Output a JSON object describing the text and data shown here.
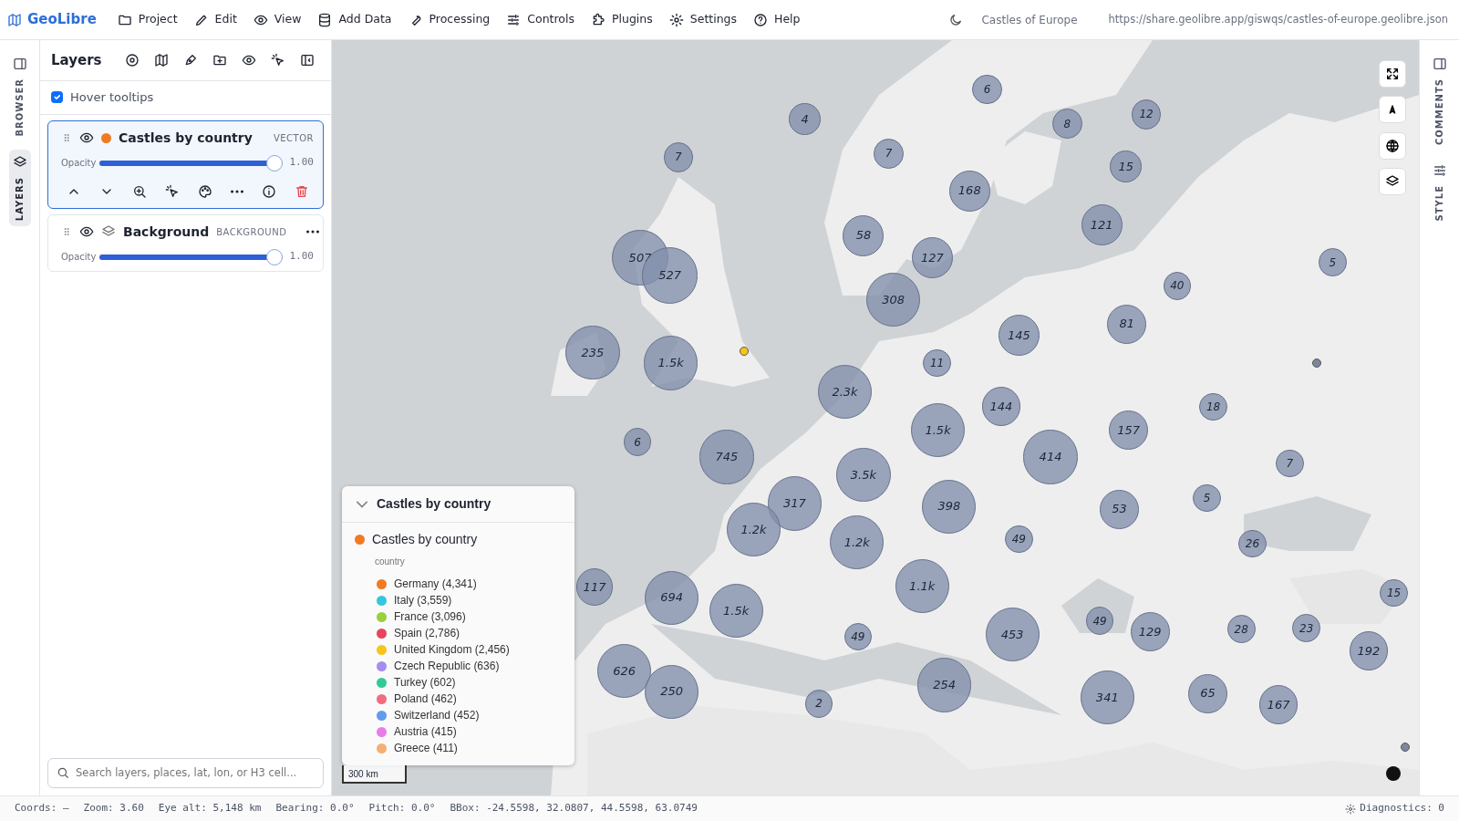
{
  "app": {
    "name": "GeoLibre"
  },
  "menu": [
    {
      "label": "Project"
    },
    {
      "label": "Edit"
    },
    {
      "label": "View"
    },
    {
      "label": "Add Data"
    },
    {
      "label": "Processing"
    },
    {
      "label": "Controls"
    },
    {
      "label": "Plugins"
    },
    {
      "label": "Settings"
    },
    {
      "label": "Help"
    }
  ],
  "project_title": "Castles of Europe",
  "share_url": "https://share.geolibre.app/giswqs/castles-of-europe.geolibre.json",
  "left_rail": {
    "tabs": [
      {
        "label": "BROWSER",
        "selected": false
      },
      {
        "label": "LAYERS",
        "selected": true
      }
    ]
  },
  "layers_panel": {
    "title": "Layers",
    "hover_tooltips": {
      "label": "Hover tooltips",
      "checked": true
    },
    "layers": [
      {
        "kind": "vector",
        "name": "Castles by country",
        "type": "VECTOR",
        "selected": true,
        "visible": true,
        "color": "#f07b22",
        "opacity_label": "Opacity",
        "level": 1.0,
        "reading": "1.00",
        "expanded": true
      },
      {
        "kind": "background",
        "name": "Background",
        "type": "BACKGROUND",
        "selected": false,
        "visible": true,
        "opacity_label": "Opacity",
        "level": 1.0,
        "reading": "1.00",
        "expanded": false
      }
    ]
  },
  "search": {
    "placeholder": "Search layers, places, lat, lon, or H3 cell..."
  },
  "map": {
    "clusters": [
      {
        "count": "6"
      },
      {
        "count": "4"
      },
      {
        "count": "8"
      },
      {
        "count": "12"
      },
      {
        "count": "7"
      },
      {
        "count": "7"
      },
      {
        "count": "15"
      },
      {
        "count": "168"
      },
      {
        "count": "121"
      },
      {
        "count": "58"
      },
      {
        "count": "507"
      },
      {
        "count": "527"
      },
      {
        "count": "127"
      },
      {
        "count": "308"
      },
      {
        "count": "40"
      },
      {
        "count": "5"
      },
      {
        "count": "81"
      },
      {
        "count": "145"
      },
      {
        "count": "235"
      },
      {
        "count": "1.5k"
      },
      {
        "count": "11"
      },
      {
        "count": "2.3k"
      },
      {
        "count": "144"
      },
      {
        "count": "18"
      },
      {
        "count": "1.5k"
      },
      {
        "count": "157"
      },
      {
        "count": "6"
      },
      {
        "count": "745"
      },
      {
        "count": "414"
      },
      {
        "count": "3.5k"
      },
      {
        "count": "7"
      },
      {
        "count": "5"
      },
      {
        "count": "317"
      },
      {
        "count": "398"
      },
      {
        "count": "53"
      },
      {
        "count": "1.2k"
      },
      {
        "count": "1.2k"
      },
      {
        "count": "49"
      },
      {
        "count": "26"
      },
      {
        "count": "117"
      },
      {
        "count": "694"
      },
      {
        "count": "1.1k"
      },
      {
        "count": "1.5k"
      },
      {
        "count": "15"
      },
      {
        "count": "49"
      },
      {
        "count": "49"
      },
      {
        "count": "453"
      },
      {
        "count": "129"
      },
      {
        "count": "28"
      },
      {
        "count": "23"
      },
      {
        "count": "192"
      },
      {
        "count": "626"
      },
      {
        "count": "250"
      },
      {
        "count": "2"
      },
      {
        "count": "254"
      },
      {
        "count": "341"
      },
      {
        "count": "65"
      },
      {
        "count": "167"
      }
    ],
    "points": [
      {
        "color": "#f5c518"
      },
      {
        "color": "#7c879e"
      },
      {
        "color": "#7c879e"
      }
    ],
    "legend": {
      "title": "Castles by country",
      "expanded": true,
      "layer": {
        "name": "Castles by country",
        "color": "#f07b22"
      },
      "field": "country",
      "entries": [
        {
          "label": "Germany (4,341)",
          "color": "#f07b22"
        },
        {
          "label": "Italy (3,559)",
          "color": "#35c6e0"
        },
        {
          "label": "France (3,096)",
          "color": "#9ad03c"
        },
        {
          "label": "Spain (2,786)",
          "color": "#e8455c"
        },
        {
          "label": "United Kingdom (2,456)",
          "color": "#f5c518"
        },
        {
          "label": "Czech Republic (636)",
          "color": "#a58cf0"
        },
        {
          "label": "Turkey (602)",
          "color": "#34c79a"
        },
        {
          "label": "Poland (462)",
          "color": "#f26d7d"
        },
        {
          "label": "Switzerland (452)",
          "color": "#5e9cf0"
        },
        {
          "label": "Austria (415)",
          "color": "#e87de8"
        },
        {
          "label": "Greece (411)",
          "color": "#f5b072"
        }
      ]
    },
    "scale": "300 km"
  },
  "right_rail": {
    "tabs": [
      {
        "label": "COMMENTS",
        "selected": false
      },
      {
        "label": "STYLE",
        "selected": false
      }
    ]
  },
  "status_bar": {
    "items": [
      "Coords: —",
      "Zoom: 3.60",
      "Eye alt: 5,148 km",
      "Bearing: 0.0°",
      "Pitch: 0.0°",
      "BBox: -24.5598, 32.0807, 44.5598, 63.0749"
    ],
    "diagnostics": "Diagnostics: 0"
  }
}
